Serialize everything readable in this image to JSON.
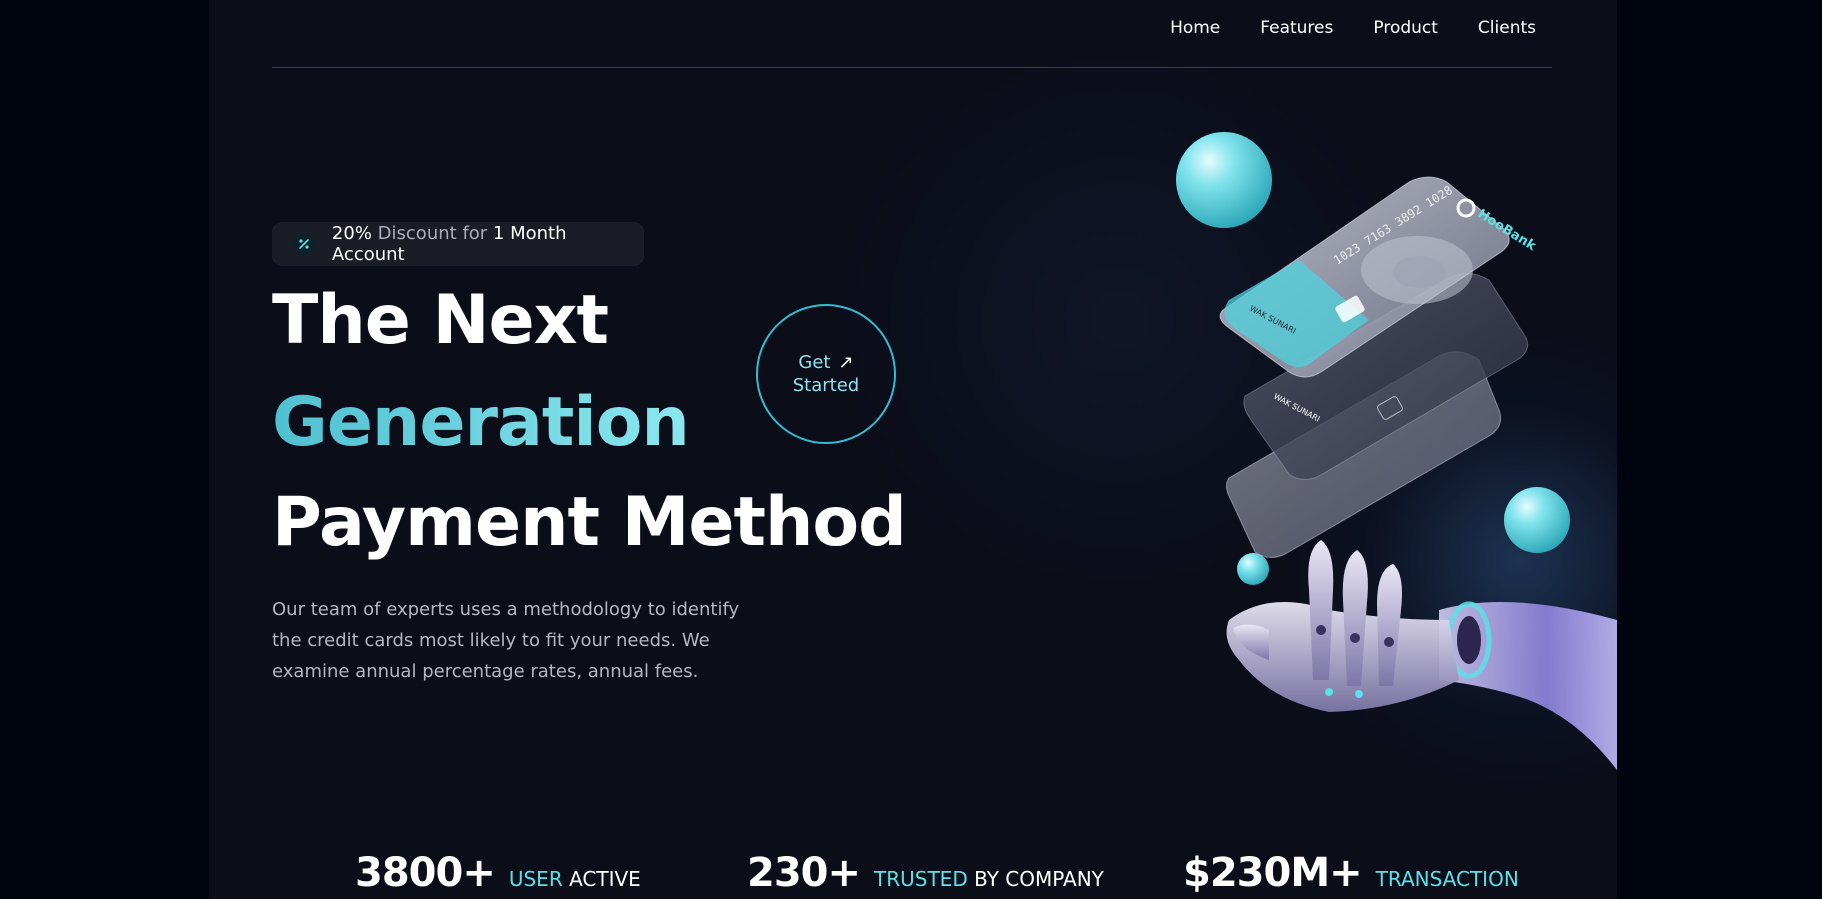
{
  "nav": {
    "links": [
      "Home",
      "Features",
      "Product",
      "Clients"
    ]
  },
  "promo": {
    "percent": "20%",
    "discount_text": "Discount",
    "for_text": "for",
    "period": "1 Month",
    "account_text": "Account",
    "icon": "discount-icon"
  },
  "hero": {
    "line1": "The Next",
    "line2": "Generation",
    "line3": "Payment Method",
    "description": "Our team of experts uses a methodology to identify the credit cards most likely to fit your needs. We examine annual percentage rates, annual fees."
  },
  "cta": {
    "line1": "Get",
    "line2": "Started",
    "icon": "arrow-up-right-icon"
  },
  "illustration": {
    "card_number": "1023 7163 3892 1028",
    "card_brand": "HooBank",
    "card_holder": "WAK SUNARI"
  },
  "stats": [
    {
      "value": "3800+",
      "label_accent": "USER",
      "label": "ACTIVE"
    },
    {
      "value": "230+",
      "label_accent": "TRUSTED",
      "label": "BY COMPANY"
    },
    {
      "value": "$230M+",
      "label_accent": "TRANSACTION",
      "label": ""
    }
  ],
  "colors": {
    "accent": "#5ce1e6",
    "background": "#0b0d19",
    "outer_background": "#00040f"
  }
}
